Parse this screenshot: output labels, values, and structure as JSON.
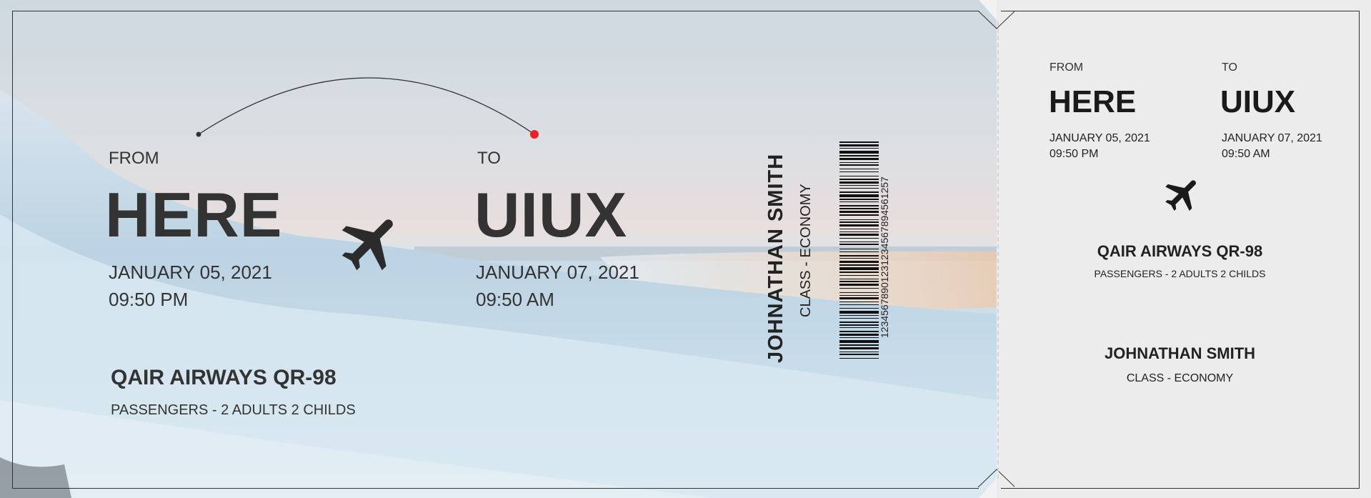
{
  "ticket": {
    "from_label": "FROM",
    "to_label": "TO",
    "from_city": "HERE",
    "to_city": "UIUX",
    "depart_date": "JANUARY 05, 2021",
    "depart_time": "09:50 PM",
    "arrive_date": "JANUARY 07, 2021",
    "arrive_time": "09:50 AM",
    "airline": "QAIR AIRWAYS QR-98",
    "passengers": "PASSENGERS - 2 ADULTS 2 CHILDS",
    "passenger_name": "JOHNATHAN SMITH",
    "class": "CLASS - ECONOMY",
    "barcode_number": "12345678901231234567894561257",
    "icon": "airplane-icon",
    "arc_end_color": "#e8222a"
  },
  "stub": {
    "from_label": "FROM",
    "to_label": "TO",
    "from_city": "HERE",
    "to_city": "UIUX",
    "depart_date": "JANUARY 05, 2021",
    "depart_time": "09:50 PM",
    "arrive_date": "JANUARY 07, 2021",
    "arrive_time": "09:50 AM",
    "airline": "QAIR AIRWAYS QR-98",
    "passengers": "PASSENGERS - 2 ADULTS 2 CHILDS",
    "passenger_name": "JOHNATHAN SMITH",
    "class": "CLASS - ECONOMY",
    "icon": "airplane-icon"
  }
}
